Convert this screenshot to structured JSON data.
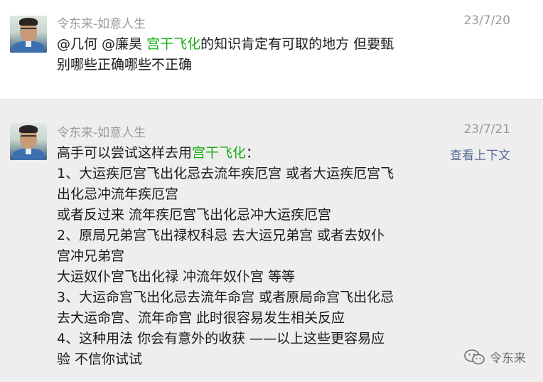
{
  "messages": [
    {
      "sender": "令东来-如意人生",
      "date": "23/7/20",
      "line1_pre": "@几何 @廉昊 ",
      "line1_link": "宫干飞化",
      "line1_post": "的知识肯定有可取的地方 但要甄",
      "line2": "别哪些正确哪些不正确"
    },
    {
      "sender": "令东来-如意人生",
      "date": "23/7/21",
      "context_link": "查看上下文",
      "intro_pre": "高手可以尝试这样去用",
      "intro_link": "宫干飞化",
      "intro_post": "：",
      "lines": [
        "1、大运疾厄宫飞出化忌去流年疾厄宫 或者大运疾厄宫飞",
        "出化忌冲流年疾厄宫",
        "或者反过来 流年疾厄宫飞出化忌冲大运疾厄宫",
        "2、原局兄弟宫飞出禄权科忌 去大运兄弟宫 或者去奴仆",
        "宫冲兄弟宫",
        "大运奴仆宫飞出化禄 冲流年奴仆宫 等等",
        "3、大运命宫飞出化忌去流年命宫 或者原局命宫飞出化忌",
        "去大运命宫、流年命宫 此时很容易发生相关反应",
        "4、这种用法 你会有意外的收获 ——以上这些更容易应",
        "验 不信你试试"
      ]
    }
  ],
  "watermark": {
    "label": "令东来",
    "icon": "wechat-icon"
  },
  "colors": {
    "link_green": "#1aad19",
    "link_blue": "#576b95",
    "meta_gray": "#9a9a9a"
  }
}
